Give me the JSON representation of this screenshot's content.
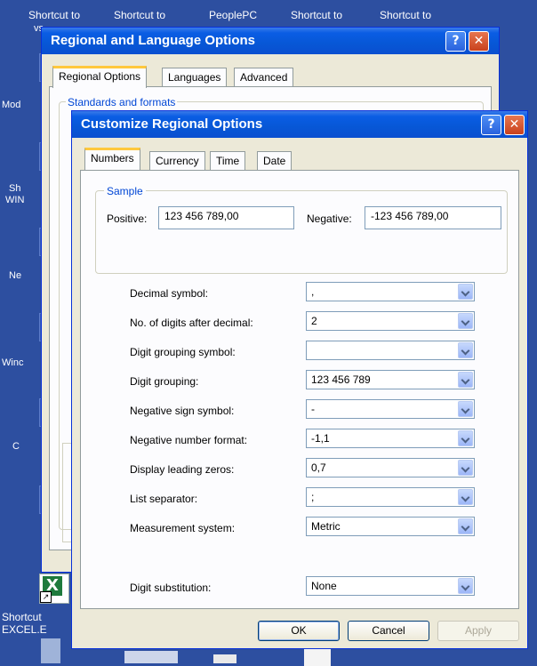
{
  "desktop": {
    "top_labels": [
      "Shortcut to",
      "Shortcut to",
      "PeoplePC",
      "Shortcut to",
      "Shortcut to"
    ],
    "top_fragment": "vs",
    "side_labels": [
      "Mod",
      "Sh",
      "WIN",
      "Ne",
      "Winc",
      "C"
    ],
    "excel_label_line1": "Shortcut",
    "excel_label_line2": "EXCEL.E"
  },
  "back_window": {
    "title": "Regional and Language Options",
    "tabs": [
      "Regional Options",
      "Languages",
      "Advanced"
    ],
    "group_label": "Standards and formats"
  },
  "dialog": {
    "title": "Customize Regional Options",
    "tabs": [
      "Numbers",
      "Currency",
      "Time",
      "Date"
    ],
    "sample": {
      "group_label": "Sample",
      "positive_label": "Positive:",
      "positive_value": "123 456 789,00",
      "negative_label": "Negative:",
      "negative_value": "-123 456 789,00"
    },
    "settings": [
      {
        "label": "Decimal symbol:",
        "value": ","
      },
      {
        "label": "No. of digits after decimal:",
        "value": "2"
      },
      {
        "label": "Digit grouping symbol:",
        "value": ""
      },
      {
        "label": "Digit grouping:",
        "value": "123 456 789"
      },
      {
        "label": "Negative sign symbol:",
        "value": "-"
      },
      {
        "label": "Negative number format:",
        "value": "-1,1"
      },
      {
        "label": "Display leading zeros:",
        "value": "0,7"
      },
      {
        "label": "List separator:",
        "value": ";"
      },
      {
        "label": "Measurement system:",
        "value": "Metric"
      },
      {
        "label": "Digit substitution:",
        "value": "None"
      }
    ],
    "buttons": {
      "ok": "OK",
      "cancel": "Cancel",
      "apply": "Apply"
    }
  },
  "colors": {
    "desktop": "#2d4fa0",
    "title_bar": "#0757d6",
    "dialog_face": "#ece9d8",
    "close_button": "#c9411d"
  }
}
